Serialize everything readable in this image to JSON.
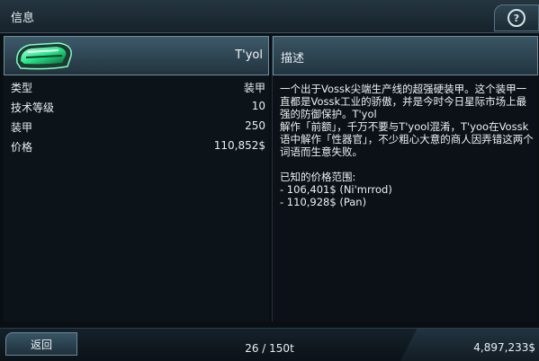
{
  "window": {
    "title": "信息",
    "help_icon": "help-icon"
  },
  "item": {
    "name": "T'yol",
    "icon": "green-armor-icon",
    "stats": [
      {
        "label": "类型",
        "value": "装甲"
      },
      {
        "label": "技术等级",
        "value": "10"
      },
      {
        "label": "装甲",
        "value": "250"
      },
      {
        "label": "价格",
        "value": "110,852$"
      }
    ]
  },
  "description": {
    "title": "描述",
    "paragraph1": "一个出于Vossk尖端生产线的超强硬装甲。这个装甲一直都是Vossk工业的骄傲，并是今时今日星际市场上最强的防御保护。T'yol",
    "paragraph2": "解作「前额」，千万不要与T'yool混淆，T'yoo在Vossk语中解作「性器官」，不少粗心大意的商人因弄错这两个词语而生意失败。",
    "price_range_title": "已知的价格范围:",
    "price_range": [
      "- 106,401$ (Ni'mrrod)",
      "- 110,928$ (Pan)"
    ]
  },
  "footer": {
    "back_label": "返回",
    "cargo": "26 / 150t",
    "credits": "4,897,233$"
  },
  "colors": {
    "accent": "#6f8d9c",
    "item_glow": "#27e58a"
  }
}
